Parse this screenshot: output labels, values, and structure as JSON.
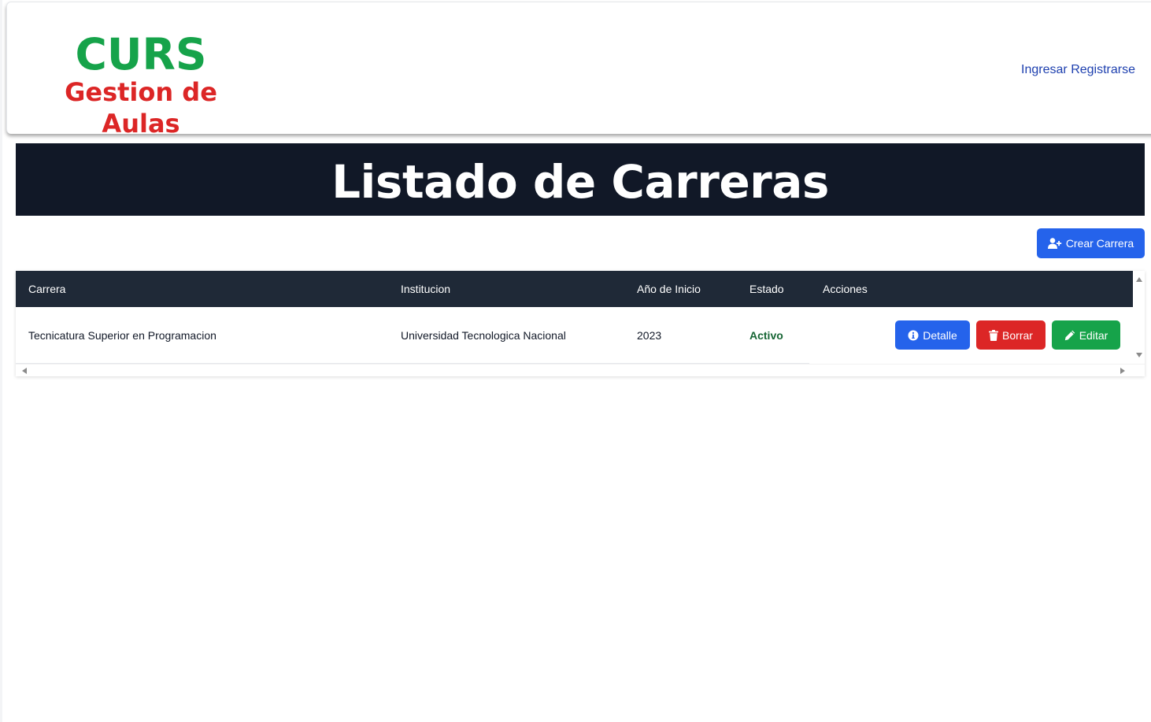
{
  "header": {
    "brand_title": "CURS",
    "brand_subtitle": "Gestion de Aulas",
    "nav": {
      "login": "Ingresar",
      "register": "Registrarse"
    }
  },
  "banner": {
    "title": "Listado de Carreras"
  },
  "toolbar": {
    "create_label": "Crear Carrera",
    "create_icon": "user-plus-icon"
  },
  "table": {
    "columns": [
      "Carrera",
      "Institucion",
      "Año de Inicio",
      "Estado",
      "Acciones"
    ],
    "rows": [
      {
        "carrera": "Tecnicatura Superior en Programacion",
        "institucion": "Universidad Tecnologica Nacional",
        "anio": "2023",
        "estado": "Activo",
        "actions": {
          "detail": "Detalle",
          "delete": "Borrar",
          "edit": "Editar"
        }
      }
    ]
  },
  "colors": {
    "brand_green": "#16a34a",
    "brand_red": "#dc2626",
    "banner_bg": "#111827",
    "table_header_bg": "#1f2937",
    "primary_blue": "#2563eb",
    "status_active": "#166534"
  }
}
